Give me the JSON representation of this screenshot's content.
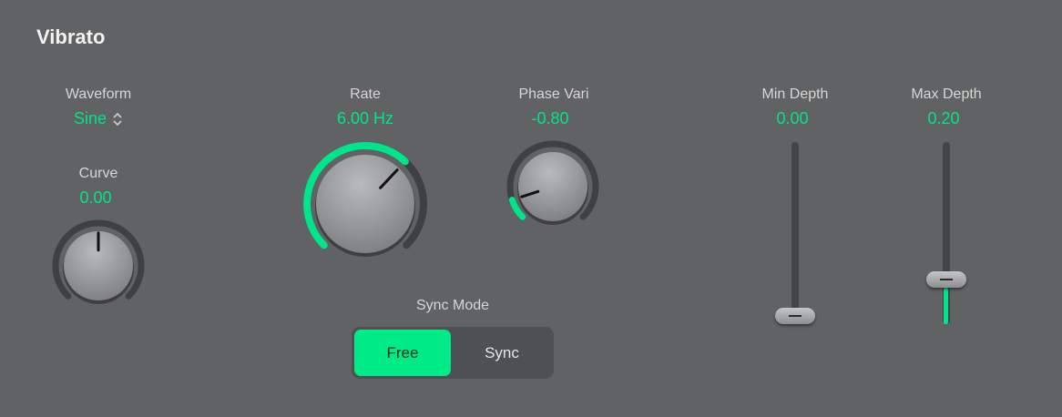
{
  "title": "Vibrato",
  "waveform": {
    "label": "Waveform",
    "value": "Sine"
  },
  "curve": {
    "label": "Curve",
    "value": "0.00",
    "level": 0.5
  },
  "rate": {
    "label": "Rate",
    "value": "6.00 Hz",
    "level": 0.66
  },
  "phase_vari": {
    "label": "Phase Vari",
    "value": "-0.80",
    "level": 0.1
  },
  "sync_mode": {
    "label": "Sync Mode",
    "options": [
      "Free",
      "Sync"
    ],
    "selected": "Free"
  },
  "min_depth": {
    "label": "Min Depth",
    "value": "0.00",
    "level": 0.0
  },
  "max_depth": {
    "label": "Max Depth",
    "value": "0.20",
    "level": 0.2
  },
  "colors": {
    "accent": "#00e58a",
    "background": "#616264"
  }
}
